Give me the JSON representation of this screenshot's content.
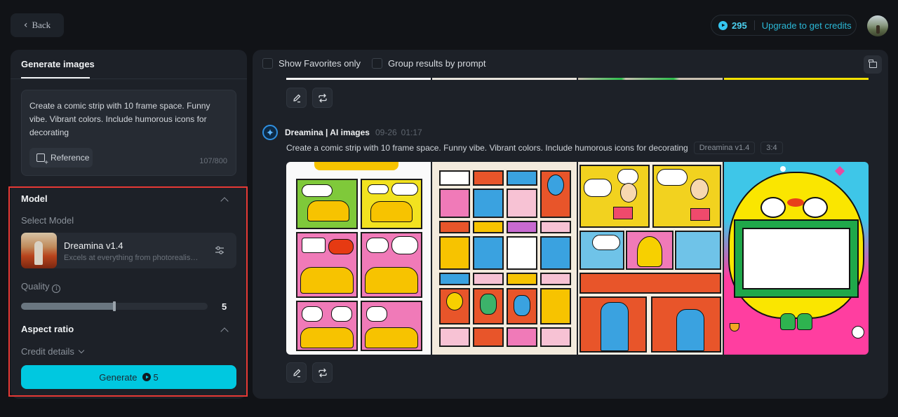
{
  "topbar": {
    "back_label": "Back",
    "credits": "295",
    "upgrade_label": "Upgrade to get credits"
  },
  "left_panel": {
    "tab_label": "Generate images",
    "prompt_text": "Create a comic strip with 10 frame space. Funny vibe. Vibrant colors. Include humorous icons for decorating",
    "reference_label": "Reference",
    "char_count": "107/800",
    "model_section": {
      "title": "Model",
      "select_label": "Select Model",
      "model_name": "Dreamina v1.4",
      "model_desc": "Excels at everything from photorealism to painterly styles",
      "quality_label": "Quality",
      "quality_value": "5",
      "quality_fraction": 0.5
    },
    "aspect_ratio_title": "Aspect ratio",
    "credit_details_label": "Credit details",
    "generate_label": "Generate",
    "generate_cost": "5"
  },
  "main_panel": {
    "filters": [
      {
        "label": "Show Favorites only",
        "checked": false
      },
      {
        "label": "Group results by prompt",
        "checked": false
      }
    ],
    "generation": {
      "source": "Dreamina | AI images",
      "date": "09-26",
      "time": "01:17",
      "prompt": "Create a comic strip with 10 frame space. Funny vibe. Vibrant colors. Include humorous icons for decorating",
      "model_tag": "Dreamina v1.4",
      "ratio_tag": "3:4",
      "images": [
        {
          "alt": "Comic strip grid with yellow characters and speech bubbles on pink and green panels"
        },
        {
          "alt": "Grid of colorful character portraits and word tiles on cream background"
        },
        {
          "alt": "Comic panels with glasses-wearing characters and laptops"
        },
        {
          "alt": "Yellow cloud character holding a blank green-framed sign on pink and cyan background"
        }
      ]
    }
  },
  "colors": {
    "accent": "#00c8e0",
    "credit_text": "#4bd0ef",
    "highlight": "#e53935",
    "background": "#111317",
    "panel": "#1d2128"
  }
}
